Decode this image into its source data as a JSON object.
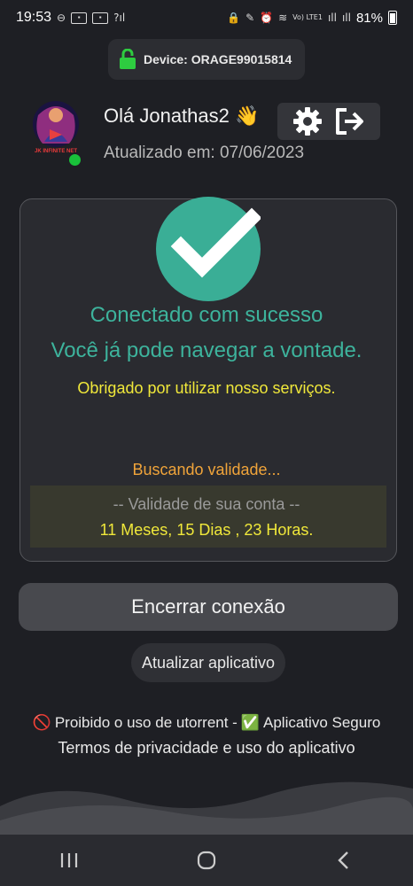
{
  "status_bar": {
    "time": "19:53",
    "network_label": "Vo) LTE1",
    "battery": "81%"
  },
  "device": {
    "label": "Device: ORAGE99015814"
  },
  "header": {
    "greeting": "Olá Jonathas2 👋",
    "updated": "Atualizado em: 07/06/2023",
    "avatar_brand": "JK INFINITE NET"
  },
  "status": {
    "title": "Conectado com sucesso",
    "subtitle": "Você já pode navegar a vontade.",
    "thanks": "Obrigado por utilizar nosso serviços.",
    "searching": "Buscando validade...",
    "validity_label": "-- Validade de sua conta --",
    "validity_value": "11 Meses, 15 Dias , 23 Horas."
  },
  "buttons": {
    "end_connection": "Encerrar conexão",
    "update_app": "Atualizar aplicativo"
  },
  "footer": {
    "prohibited_emoji": "🚫",
    "prohibited": "Proibido o uso de utorrent -",
    "safe_emoji": "✅",
    "safe": "Aplicativo Seguro",
    "terms": "Termos de privacidade e uso do aplicativo"
  },
  "colors": {
    "background": "#1e1f24",
    "success": "#3db39c",
    "check_circle": "#3aae96",
    "thanks": "#f0e83a",
    "searching": "#f0a43a",
    "online": "#19c13a",
    "lock": "#2ecc40"
  },
  "icons": {
    "lock": "lock-icon",
    "settings": "gear-icon",
    "logout": "logout-icon",
    "check": "check-icon",
    "nav_recent": "recent-apps-icon",
    "nav_home": "home-icon",
    "nav_back": "back-icon"
  }
}
